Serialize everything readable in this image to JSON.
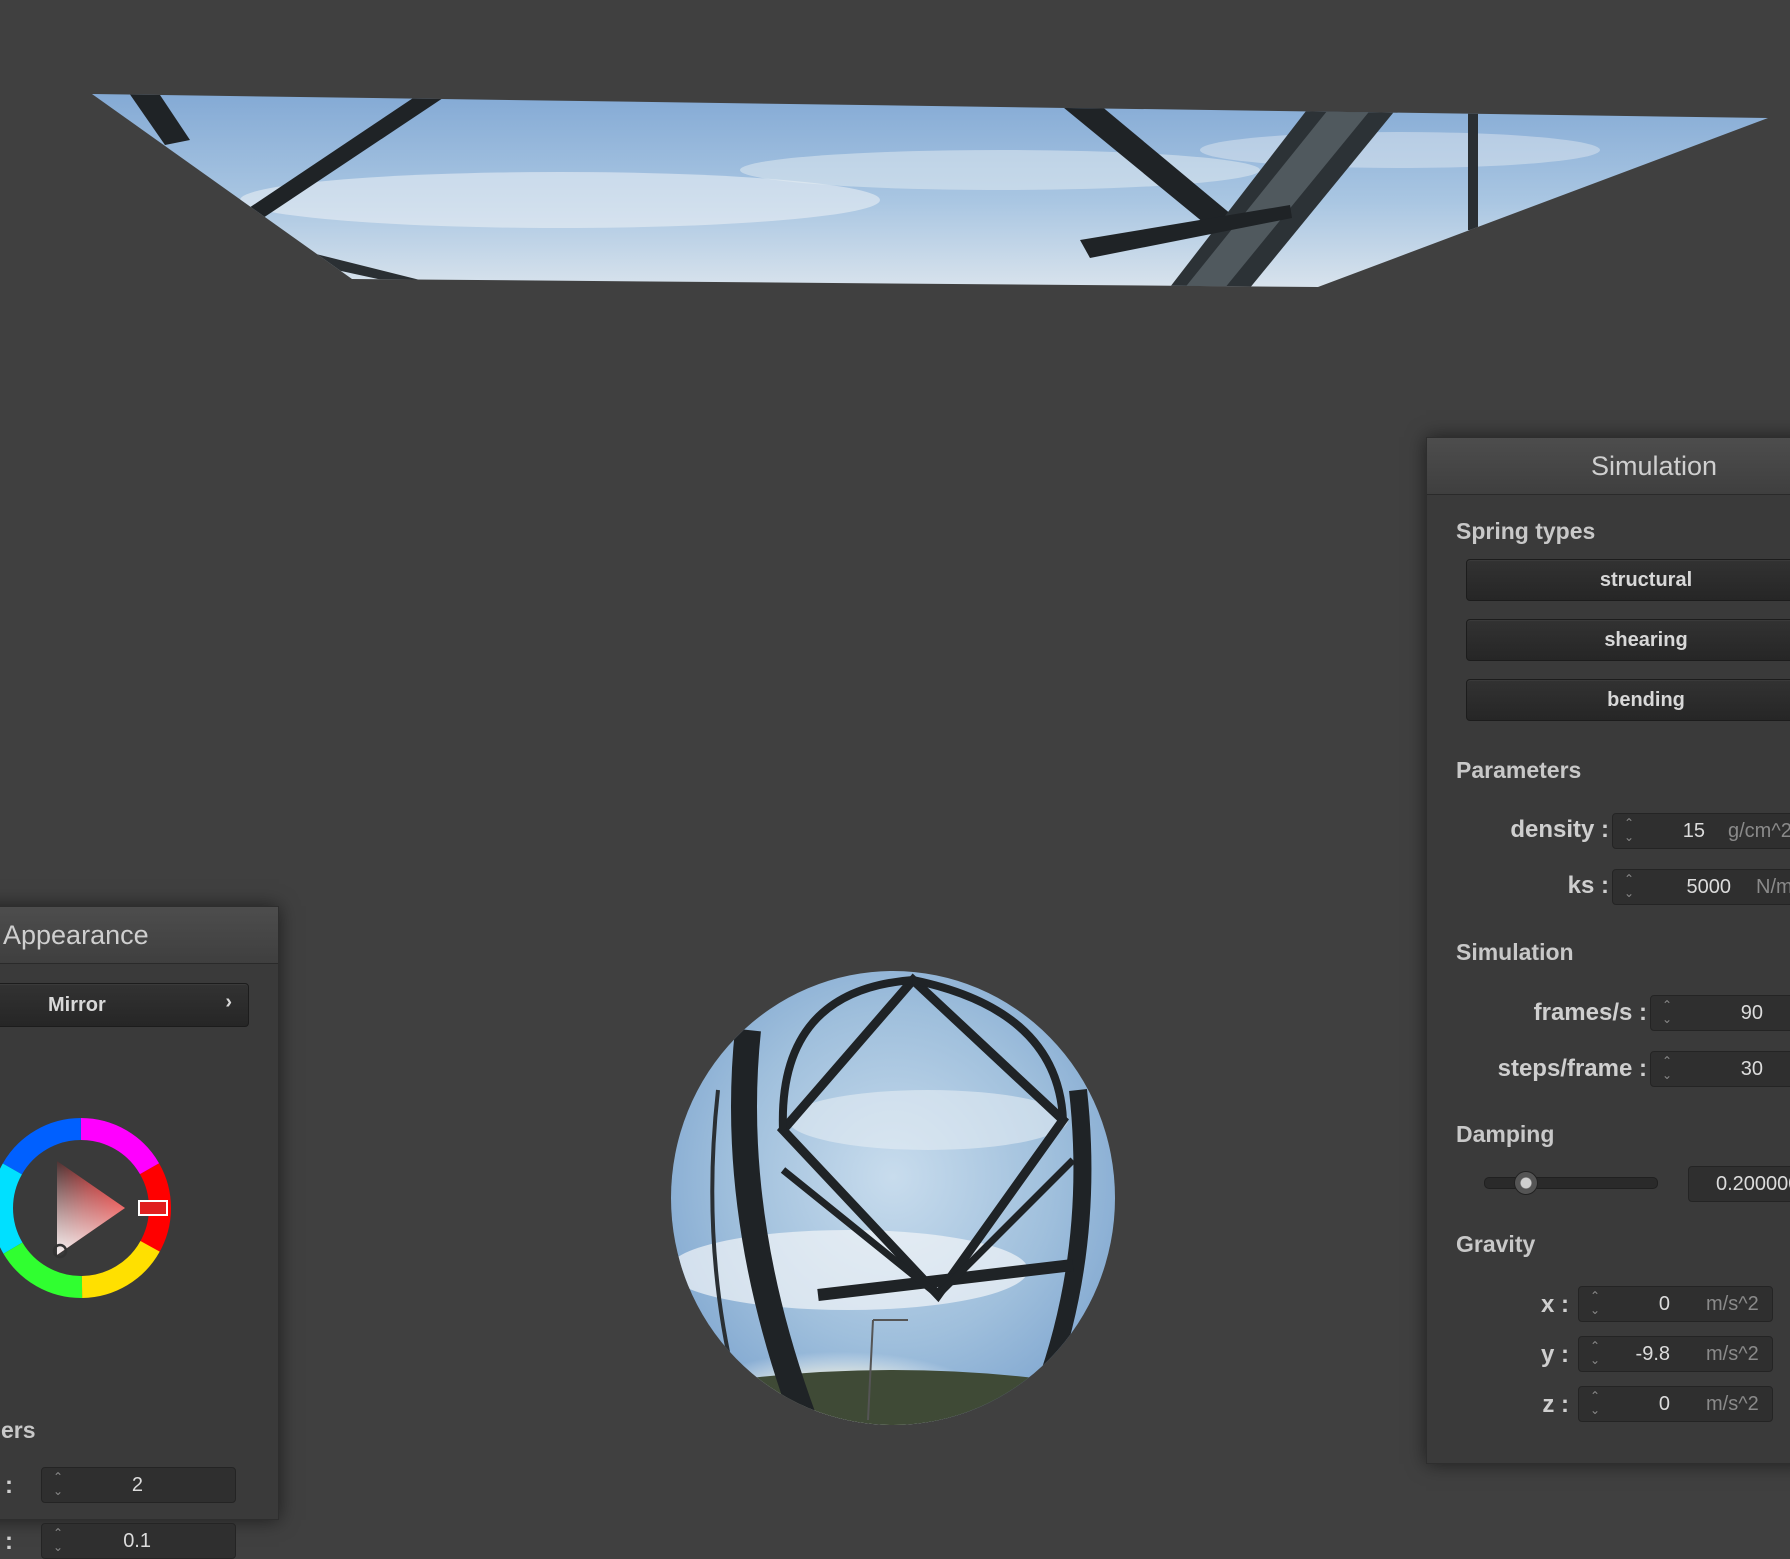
{
  "simulation_panel": {
    "title": "Simulation",
    "spring_types": {
      "heading": "Spring types",
      "buttons": [
        "structural",
        "shearing",
        "bending"
      ]
    },
    "parameters": {
      "heading": "Parameters",
      "density": {
        "label": "density :",
        "value": "15",
        "unit": "g/cm^2"
      },
      "ks": {
        "label": "ks :",
        "value": "5000",
        "unit": "N/m"
      }
    },
    "simulation": {
      "heading": "Simulation",
      "frames": {
        "label": "frames/s :",
        "value": "90"
      },
      "steps": {
        "label": "steps/frame :",
        "value": "30"
      }
    },
    "damping": {
      "heading": "Damping",
      "value": "0.200000",
      "slider_fraction": 0.2
    },
    "gravity": {
      "heading": "Gravity",
      "x": {
        "label": "x :",
        "value": "0",
        "unit": "m/s^2"
      },
      "y": {
        "label": "y :",
        "value": "-9.8",
        "unit": "m/s^2"
      },
      "z": {
        "label": "z :",
        "value": "0",
        "unit": "m/s^2"
      }
    }
  },
  "appearance_panel": {
    "title": "Appearance",
    "shader_select": {
      "selected": "Mirror",
      "icon": "chevron-right-icon"
    },
    "color_wheel": {
      "hue_color": "#e0201e",
      "icon": "color-wheel"
    },
    "parameters": {
      "heading_fragment": "ers",
      "row1": {
        "label_fragment": ":",
        "value": "2"
      },
      "row2": {
        "label_fragment": ":",
        "value": "0.1"
      }
    }
  },
  "colors": {
    "background": "#404040",
    "panel": "#3a3a3a",
    "sky": "#a9c6e2",
    "bridge_steel": "#1f2326"
  }
}
